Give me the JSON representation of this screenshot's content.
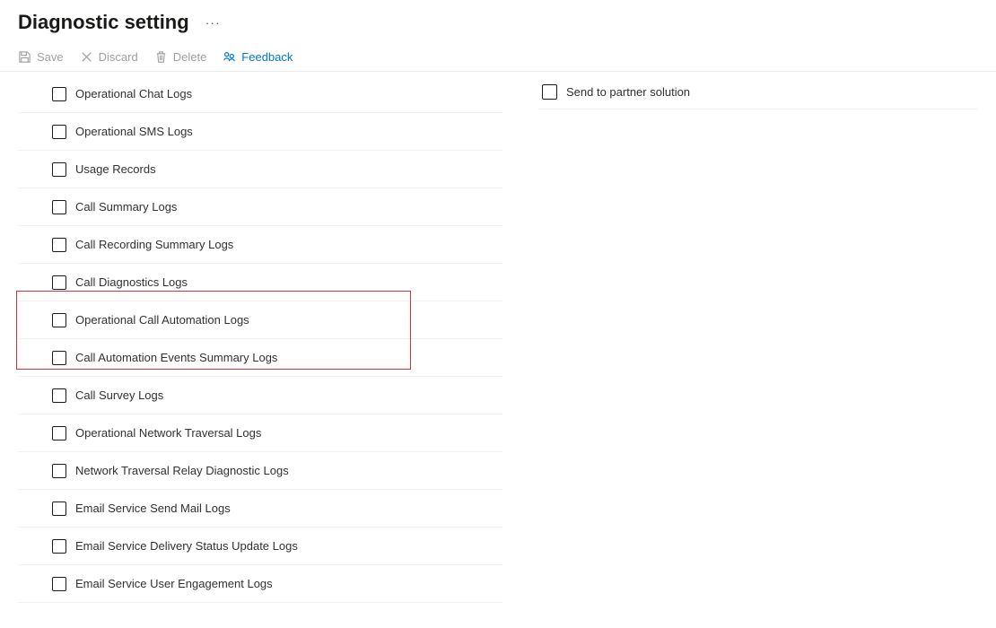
{
  "header": {
    "title": "Diagnostic setting"
  },
  "commands": {
    "save": "Save",
    "discard": "Discard",
    "delete": "Delete",
    "feedback": "Feedback"
  },
  "destination": {
    "partner_label": "Send to partner solution"
  },
  "logs": {
    "items": [
      {
        "label": "Operational Chat Logs"
      },
      {
        "label": "Operational SMS Logs"
      },
      {
        "label": "Usage Records"
      },
      {
        "label": "Call Summary Logs"
      },
      {
        "label": "Call Recording Summary Logs"
      },
      {
        "label": "Call Diagnostics Logs"
      },
      {
        "label": "Operational Call Automation Logs"
      },
      {
        "label": "Call Automation Events Summary Logs"
      },
      {
        "label": "Call Survey Logs"
      },
      {
        "label": "Operational Network Traversal Logs"
      },
      {
        "label": "Network Traversal Relay Diagnostic Logs"
      },
      {
        "label": "Email Service Send Mail Logs"
      },
      {
        "label": "Email Service Delivery Status Update Logs"
      },
      {
        "label": "Email Service User Engagement Logs"
      }
    ]
  }
}
